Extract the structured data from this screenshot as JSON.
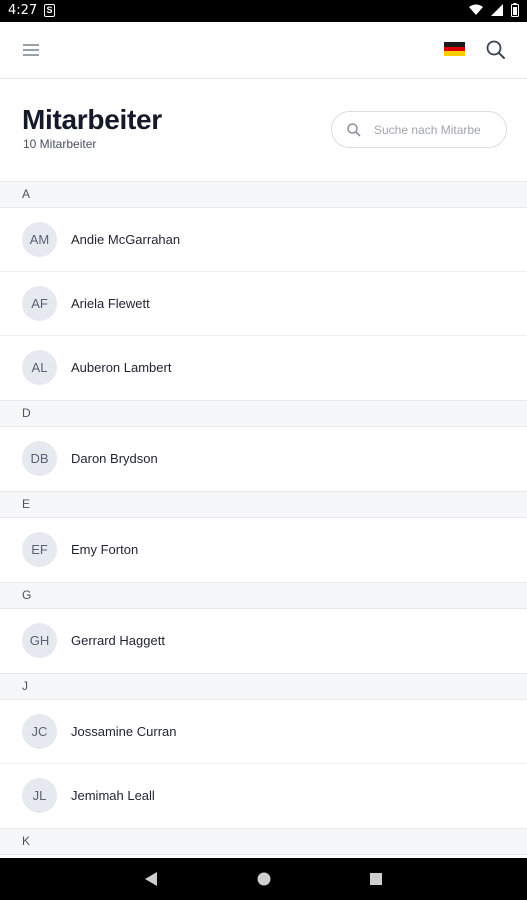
{
  "status_bar": {
    "time": "4:27",
    "notification_icon": "s-app-icon"
  },
  "app_bar": {
    "menu_icon": "hamburger-menu-icon",
    "flag_icon": "german-flag-icon",
    "search_icon": "search-icon"
  },
  "header": {
    "title": "Mitarbeiter",
    "subtitle": "10 Mitarbeiter",
    "search_placeholder": "Suche nach Mitarbe"
  },
  "sections": [
    {
      "letter": "A",
      "employees": [
        {
          "initials": "AM",
          "name": "Andie McGarrahan"
        },
        {
          "initials": "AF",
          "name": "Ariela Flewett"
        },
        {
          "initials": "AL",
          "name": "Auberon Lambert"
        }
      ]
    },
    {
      "letter": "D",
      "employees": [
        {
          "initials": "DB",
          "name": "Daron Brydson"
        }
      ]
    },
    {
      "letter": "E",
      "employees": [
        {
          "initials": "EF",
          "name": "Emy Forton"
        }
      ]
    },
    {
      "letter": "G",
      "employees": [
        {
          "initials": "GH",
          "name": "Gerrard Haggett"
        }
      ]
    },
    {
      "letter": "J",
      "employees": [
        {
          "initials": "JC",
          "name": "Jossamine Curran"
        },
        {
          "initials": "JL",
          "name": "Jemimah Leall"
        }
      ]
    },
    {
      "letter": "K",
      "employees": []
    }
  ],
  "nav_bar": {
    "back_icon": "back-triangle-icon",
    "home_icon": "home-circle-icon",
    "recents_icon": "recents-square-icon"
  },
  "colors": {
    "title": "#141a29",
    "avatar_bg": "#e6e9ef",
    "section_bg": "#f6f7f9"
  }
}
